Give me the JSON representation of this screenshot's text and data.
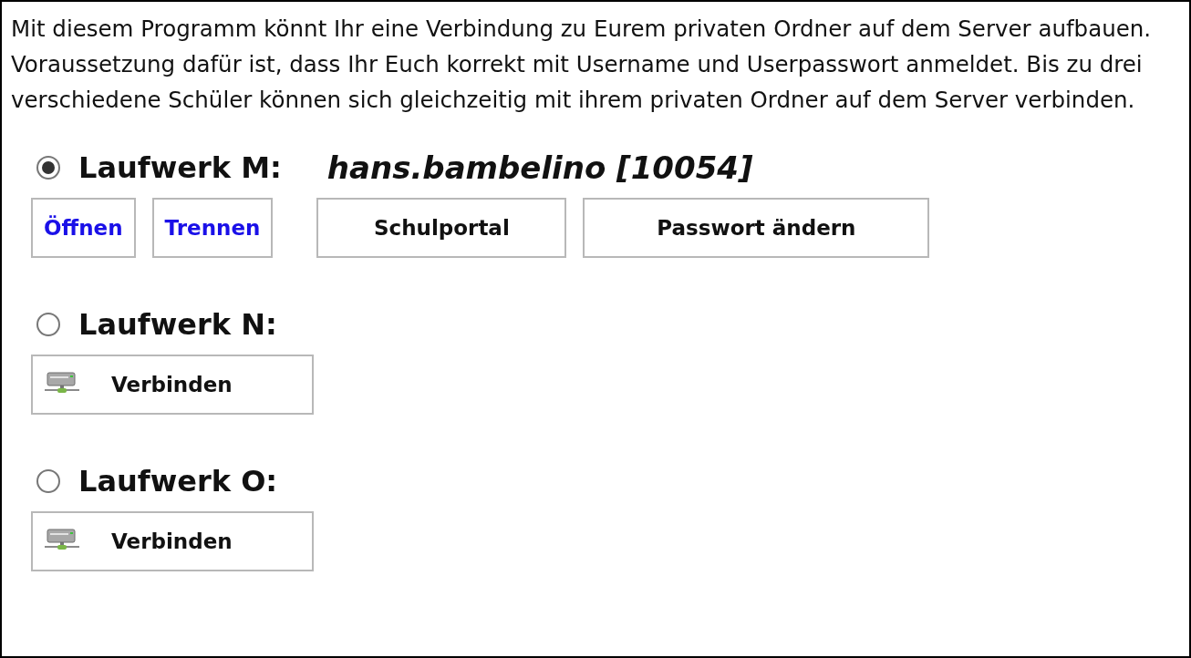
{
  "intro": "Mit diesem Programm könnt Ihr eine Verbindung zu Eurem privaten Ordner auf dem Server aufbauen. Voraussetzung dafür ist, dass Ihr Euch korrekt mit Username und Userpasswort anmeldet. Bis zu drei verschiedene Schüler können sich gleichzeitig mit ihrem privaten Ordner auf dem Server verbinden.",
  "drives": [
    {
      "label": "Laufwerk M:",
      "selected": true,
      "user": "hans.bambelino [10054]",
      "buttons": [
        {
          "label": "Öffnen",
          "kind": "link"
        },
        {
          "label": "Trennen",
          "kind": "link"
        },
        {
          "label": "Schulportal",
          "kind": "plain"
        },
        {
          "label": "Passwort ändern",
          "kind": "plain"
        }
      ]
    },
    {
      "label": "Laufwerk N:",
      "selected": false,
      "buttons": [
        {
          "label": "Verbinden",
          "kind": "connect"
        }
      ]
    },
    {
      "label": "Laufwerk O:",
      "selected": false,
      "buttons": [
        {
          "label": "Verbinden",
          "kind": "connect"
        }
      ]
    }
  ]
}
